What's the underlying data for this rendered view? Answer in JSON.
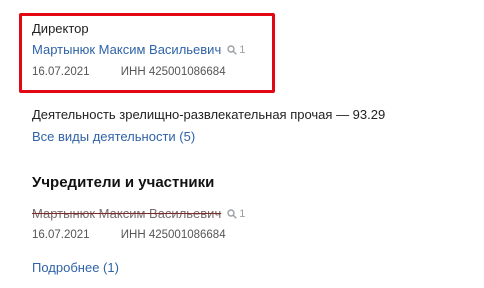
{
  "director": {
    "role": "Директор",
    "name": "Мартынюк Максим Васильевич",
    "search_count": "1",
    "date": "16.07.2021",
    "inn": "ИНН 425001086684"
  },
  "activity": {
    "text": "Деятельность зрелищно-развлекательная прочая — 93.29",
    "all_link": "Все виды деятельности (5)"
  },
  "founders": {
    "title": "Учредители и участники",
    "name": "Мартынюк Максим Васильевич",
    "search_count": "1",
    "date": "16.07.2021",
    "inn": "ИНН 425001086684",
    "more_link": "Подробнее (1)"
  },
  "colors": {
    "highlight_border": "#e30613",
    "link": "#2f63a8"
  }
}
